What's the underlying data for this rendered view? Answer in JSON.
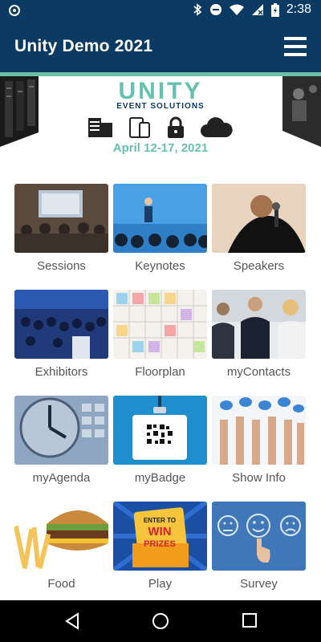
{
  "status_bar": {
    "time": "2:38"
  },
  "header": {
    "title": "Unity Demo 2021"
  },
  "banner": {
    "logo_word": "UNITY",
    "logo_sub": "EVENT SOLUTIONS",
    "date": "April 12-17, 2021"
  },
  "tiles": [
    {
      "label": "Sessions"
    },
    {
      "label": "Keynotes"
    },
    {
      "label": "Speakers"
    },
    {
      "label": "Exhibitors"
    },
    {
      "label": "Floorplan"
    },
    {
      "label": "myContacts"
    },
    {
      "label": "myAgenda"
    },
    {
      "label": "myBadge"
    },
    {
      "label": "Show Info"
    },
    {
      "label": "Food"
    },
    {
      "label": "Play"
    },
    {
      "label": "Survey"
    }
  ],
  "play_tile": {
    "prize_text_1": "ENTER TO",
    "prize_text_2": "WIN",
    "prize_text_3": "PRIZES"
  },
  "colors": {
    "header": "#0b3a63",
    "accent": "#6bbfa4"
  }
}
